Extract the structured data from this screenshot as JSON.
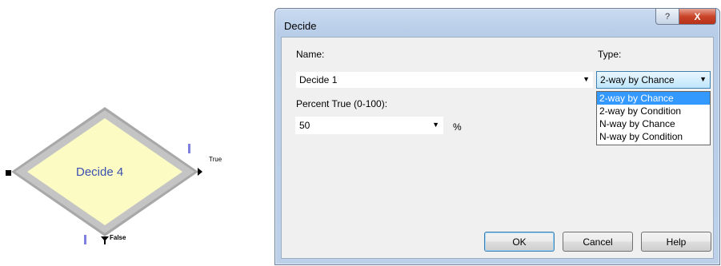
{
  "module": {
    "title": "Decide 4",
    "true_label": "True",
    "false_label": "False",
    "fill_color": "#fbfbc3",
    "border_color": "#a9a9a9"
  },
  "dialog": {
    "title": "Decide",
    "title_help_glyph": "?",
    "title_close_glyph": "X",
    "name_label": "Name:",
    "name_value": "Decide 1",
    "type_label": "Type:",
    "type_value": "2-way by Chance",
    "type_options": [
      "2-way by Chance",
      "2-way by Condition",
      "N-way by Chance",
      "N-way by Condition"
    ],
    "type_selected_index": 0,
    "percent_label": "Percent True (0-100):",
    "percent_value": "50",
    "percent_unit": "%",
    "ok_label": "OK",
    "cancel_label": "Cancel",
    "help_label": "Help",
    "accent_color": "#3399ff"
  }
}
